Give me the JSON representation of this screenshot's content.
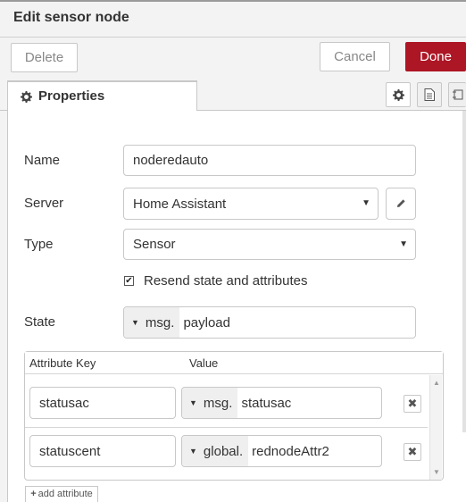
{
  "dialog": {
    "title": "Edit sensor node"
  },
  "toolbar": {
    "delete_label": "Delete",
    "cancel_label": "Cancel",
    "done_label": "Done"
  },
  "tabs": {
    "properties_label": "Properties"
  },
  "form": {
    "name_label": "Name",
    "name_value": "noderedauto",
    "server_label": "Server",
    "server_value": "Home Assistant",
    "type_label": "Type",
    "type_value": "Sensor",
    "resend_label": "Resend state and attributes",
    "resend_checked": true,
    "state_label": "State",
    "state_type": "msg.",
    "state_value": "payload"
  },
  "attributes": {
    "header_key": "Attribute Key",
    "header_value": "Value",
    "rows": [
      {
        "key": "statusac",
        "type": "msg.",
        "value": "statusac"
      },
      {
        "key": "statuscent",
        "type": "global.",
        "value": "rednodeAttr2"
      }
    ],
    "add_label": "add attribute"
  },
  "colors": {
    "accent": "#ad1625",
    "border": "#c8c8c8",
    "background": "#f3f3f3"
  },
  "icons": [
    "gear-icon",
    "document-icon",
    "frame-icon",
    "pencil-icon",
    "close-icon",
    "plus-icon",
    "checkmark-icon"
  ]
}
